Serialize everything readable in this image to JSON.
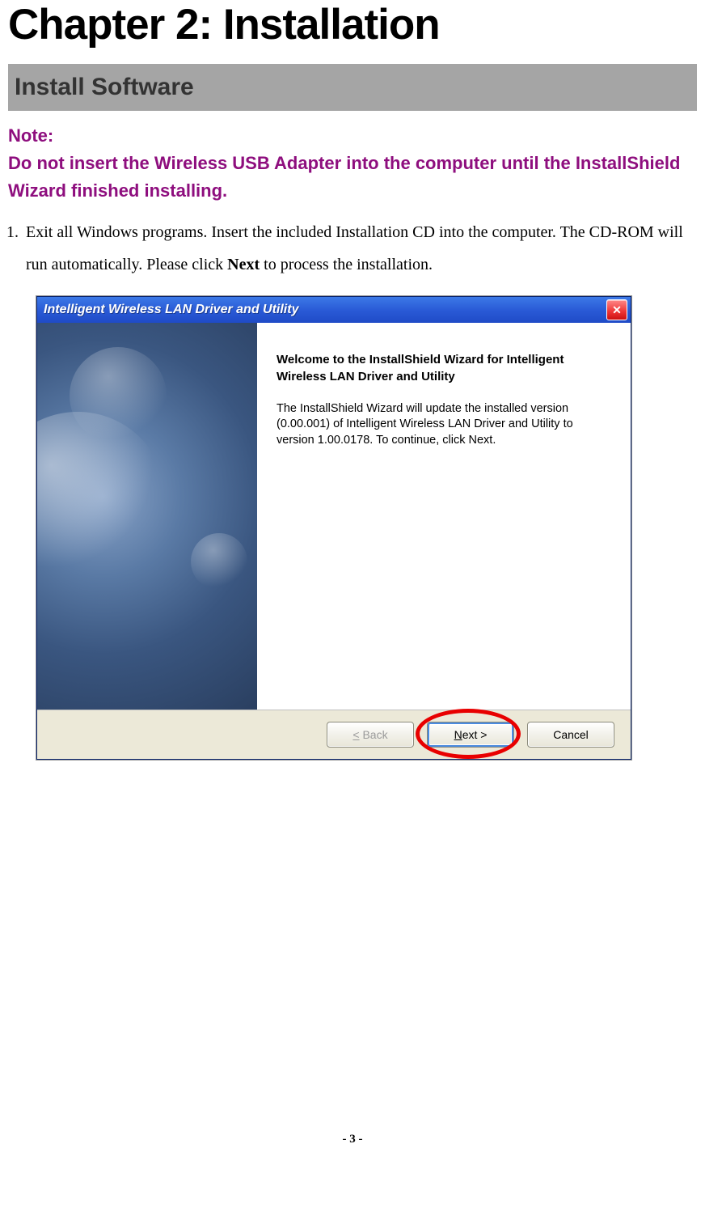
{
  "chapter_title": "Chapter 2: Installation",
  "section_title": "Install Software",
  "note": {
    "label": "Note:",
    "text": "Do not insert the Wireless USB Adapter into the computer until the InstallShield Wizard finished installing."
  },
  "step": {
    "number": "1.",
    "text_before": "Exit all Windows programs. Insert the included Installation CD into the computer. The CD-ROM will run automatically. Please click ",
    "bold_word": "Next",
    "text_after": " to process the installation."
  },
  "dialog": {
    "title": "Intelligent Wireless LAN Driver and Utility",
    "close_glyph": "✕",
    "wizard_title": "Welcome to the InstallShield Wizard for Intelligent Wireless LAN Driver and Utility",
    "wizard_text": "The InstallShield Wizard will update the installed version (0.00.001) of Intelligent Wireless LAN Driver and Utility to version 1.00.0178.  To continue, click Next.",
    "buttons": {
      "back": "< Back",
      "next": "Next >",
      "cancel": "Cancel"
    }
  },
  "page_number": "- 3 -"
}
